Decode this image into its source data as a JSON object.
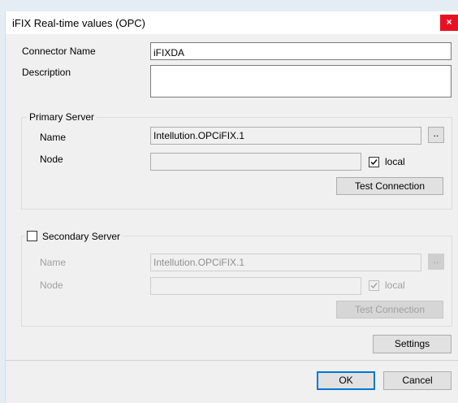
{
  "window": {
    "title": "iFIX Real-time values (OPC)",
    "close_glyph": "×"
  },
  "connector": {
    "name_label": "Connector Name",
    "name_value": "iFIXDA",
    "description_label": "Description",
    "description_value": ""
  },
  "primary": {
    "legend": "Primary Server",
    "name_label": "Name",
    "name_value": "Intellution.OPCiFIX.1",
    "browse_label": "..",
    "node_label": "Node",
    "node_value": "",
    "local_label": "local",
    "local_checked": true,
    "test_label": "Test Connection"
  },
  "secondary": {
    "legend": "Secondary Server",
    "enabled_checked": false,
    "name_label": "Name",
    "name_value": "Intellution.OPCiFIX.1",
    "browse_label": "..",
    "node_label": "Node",
    "node_value": "",
    "local_label": "local",
    "local_checked": true,
    "test_label": "Test Connection"
  },
  "footer": {
    "settings_label": "Settings",
    "ok_label": "OK",
    "cancel_label": "Cancel"
  },
  "colors": {
    "close_bg": "#e81123",
    "default_button_border": "#0078d7"
  }
}
